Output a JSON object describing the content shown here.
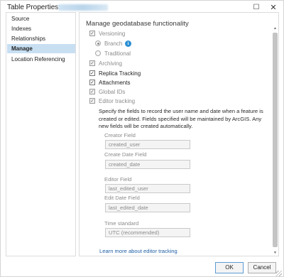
{
  "window": {
    "title": "Table Properties:",
    "maximize_glyph": "☐",
    "close_glyph": "✕"
  },
  "sidebar": {
    "items": [
      {
        "label": "Source"
      },
      {
        "label": "Indexes"
      },
      {
        "label": "Relationships"
      },
      {
        "label": "Manage",
        "selected": true
      },
      {
        "label": "Location Referencing"
      }
    ]
  },
  "manage": {
    "heading": "Manage geodatabase functionality",
    "versioning": {
      "label": "Versioning",
      "checked": true,
      "enabled": false
    },
    "branch": {
      "label": "Branch",
      "selected": true
    },
    "traditional": {
      "label": "Traditional",
      "selected": false
    },
    "archiving": {
      "label": "Archiving",
      "checked": true,
      "enabled": false
    },
    "replica_tracking": {
      "label": "Replica Tracking",
      "checked": true,
      "enabled": true
    },
    "attachments": {
      "label": "Attachments",
      "checked": true,
      "enabled": true
    },
    "global_ids": {
      "label": "Global IDs",
      "checked": true,
      "enabled": false
    },
    "editor_tracking": {
      "label": "Editor tracking",
      "checked": true,
      "enabled": false
    },
    "editor_desc": "Specify the fields to record the user name and date when a feature is created or edited. Fields specified will be maintained by ArcGIS. Any new fields will be created automatically.",
    "creator_field": {
      "label": "Creator Field",
      "value": "created_user"
    },
    "create_date_field": {
      "label": "Create Date Field",
      "value": "created_date"
    },
    "editor_field": {
      "label": "Editor Field",
      "value": "last_edited_user"
    },
    "edit_date_field": {
      "label": "Edit Date Field",
      "value": "last_edited_date"
    },
    "time_standard": {
      "label": "Time standard",
      "value": "UTC (recommended)"
    },
    "learn_more": "Learn more about editor tracking"
  },
  "footer": {
    "ok": "OK",
    "cancel": "Cancel"
  },
  "icons": {
    "check": "✓",
    "info": "i",
    "scroll_up": "▲",
    "scroll_down": "▼"
  },
  "colors": {
    "selection": "#c8dff2",
    "link": "#1f5fa6",
    "info": "#2b8fd3"
  }
}
